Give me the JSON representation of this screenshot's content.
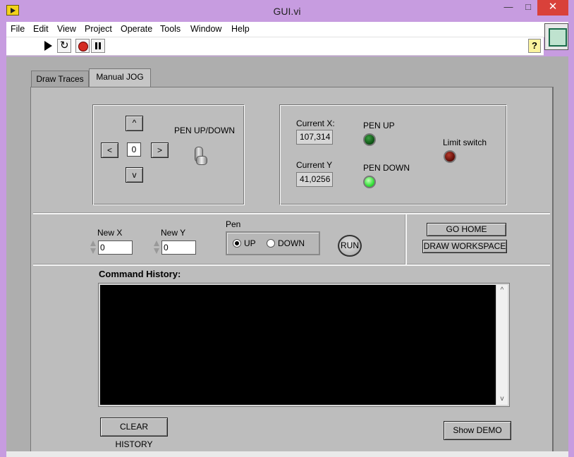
{
  "window": {
    "title": "GUI.vi",
    "minimize": "—",
    "maximize": "□",
    "close": "✕"
  },
  "menu": [
    "File",
    "Edit",
    "View",
    "Project",
    "Operate",
    "Tools",
    "Window",
    "Help"
  ],
  "toolbar": {
    "help": "?"
  },
  "tabs": [
    "Draw Traces",
    "Manual JOG"
  ],
  "active_tab": "Manual JOG",
  "jog": {
    "up": "^",
    "down": "v",
    "left": "<",
    "right": ">",
    "step": "0",
    "pen_toggle_label": "PEN UP/DOWN"
  },
  "status": {
    "current_x_label": "Current X:",
    "current_x": "107,314",
    "current_y_label": "Current Y",
    "current_y": "41,0256",
    "pen_up_label": "PEN UP",
    "pen_down_label": "PEN DOWN",
    "limit_label": "Limit switch",
    "led_pen_up": "off",
    "led_pen_down": "on",
    "led_limit": "off"
  },
  "command": {
    "new_x_label": "New X",
    "new_x": "0",
    "new_y_label": "New Y",
    "new_y": "0",
    "pen_label": "Pen",
    "pen_up": "UP",
    "pen_down": "DOWN",
    "pen_selected": "UP",
    "run": "RUN"
  },
  "actions": {
    "go_home": "GO HOME",
    "draw_workspace": "DRAW WORKSPACE"
  },
  "history": {
    "label": "Command History:",
    "scroll_up": "^",
    "scroll_down": "v"
  },
  "footer": {
    "clear_history": "CLEAR HISTORY",
    "show_demo": "Show DEMO"
  },
  "colors": {
    "panel": "#aeaeae",
    "tab_body": "#bdbdbd",
    "led_on": "#35e23a",
    "led_off": "#0c4d13",
    "limit_led": "#5a0b06",
    "history_bg": "#000000"
  }
}
